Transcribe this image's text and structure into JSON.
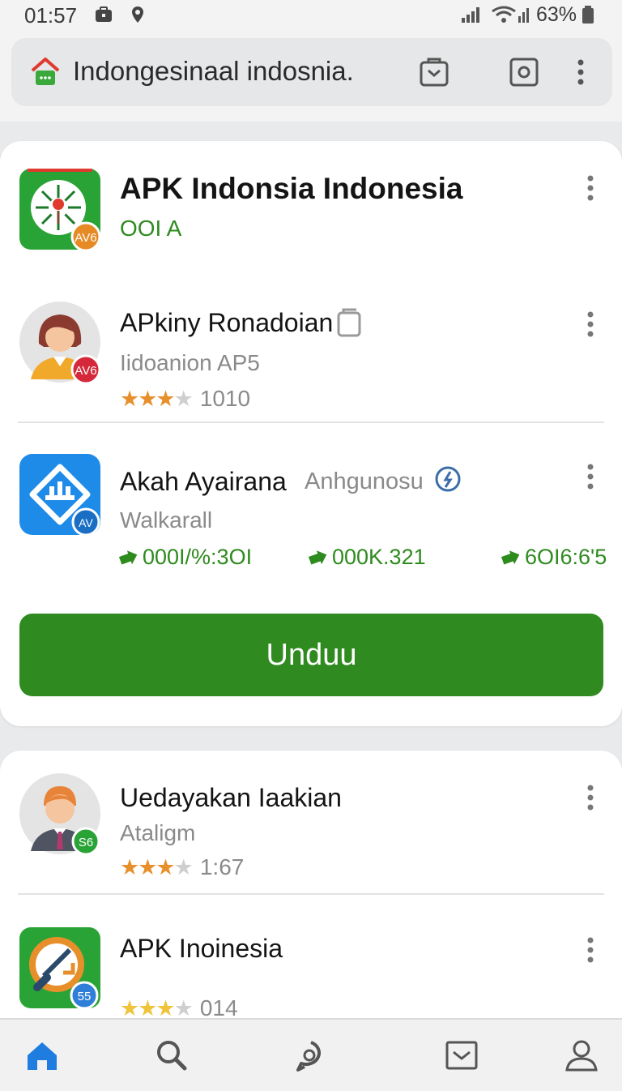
{
  "status_bar": {
    "time": "01:57",
    "battery": "63%",
    "icons": [
      "briefcase-icon",
      "location-icon",
      "signal-icon",
      "wifi-icon",
      "battery-icon"
    ]
  },
  "address_bar": {
    "url_text": "Indongesinaal indosnia.",
    "icons": [
      "home-store-icon",
      "bag-icon",
      "camera-icon",
      "menu-icon"
    ]
  },
  "card1": {
    "featured": {
      "title": "APK Indonsia Indonesia",
      "subtitle": "OOI A",
      "badge": "AV6"
    },
    "items": [
      {
        "title": "APkiny Ronadoian",
        "subtitle": "Iidoanion AP5",
        "rating_stars": 3,
        "rating_value": "1010",
        "badge": "AV6"
      },
      {
        "title": "Akah Ayairana",
        "tag": "Anhgunosu",
        "subtitle": "Walkarall",
        "badge": "AV",
        "stats": [
          "000I/%:3OI",
          "000K.321",
          "6OI6:6'5"
        ]
      }
    ],
    "button_label": "Unduu"
  },
  "card2": {
    "items": [
      {
        "title": "Uedayakan Iaakian",
        "subtitle": "Ataligm",
        "rating_stars": 3,
        "rating_value": "1:67",
        "badge": "S6"
      },
      {
        "title": "APK Inoinesia",
        "rating_stars": 3,
        "rating_value": "014",
        "badge": "55"
      }
    ]
  },
  "bottom_nav": [
    "home-icon",
    "search-icon",
    "chat-icon",
    "mail-icon",
    "profile-icon"
  ],
  "colors": {
    "accent_green": "#2f8b1f",
    "star_orange": "#e7902b",
    "nav_blue": "#1f7de0"
  }
}
